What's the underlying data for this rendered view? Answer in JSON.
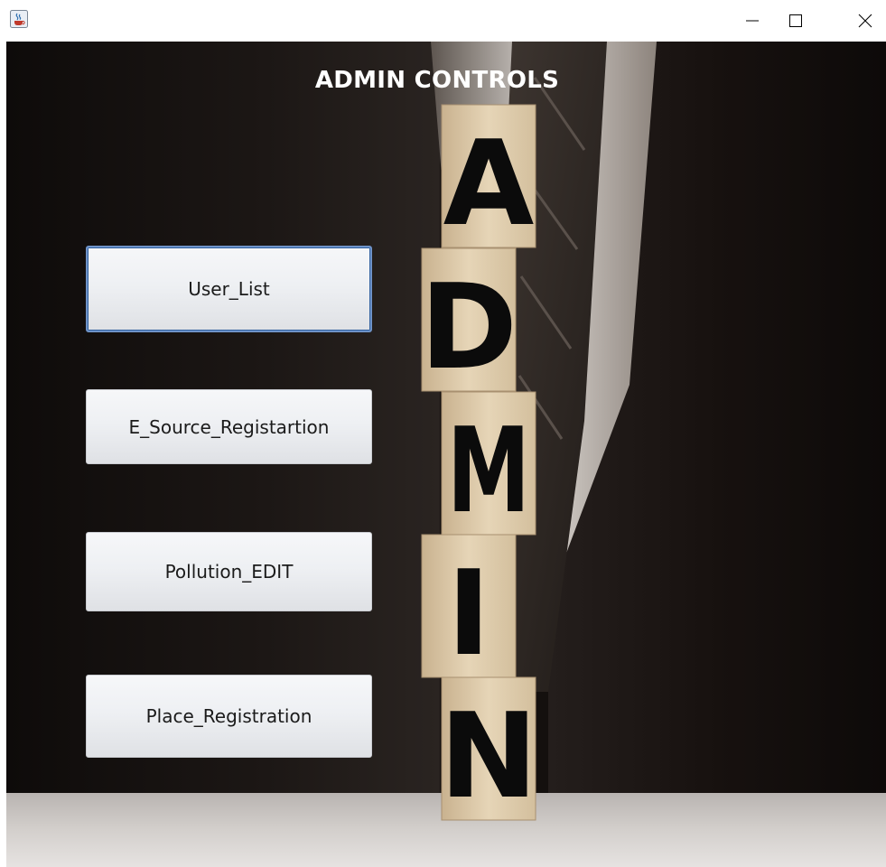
{
  "window": {
    "icon": "java-cup-icon",
    "controls": [
      "minimize-icon",
      "maximize-icon",
      "close-icon"
    ]
  },
  "heading": "ADMIN CONTROLS",
  "buttons": {
    "user_list": "User_List",
    "e_source_registration": "E_Source_Registartion",
    "pollution_edit": "Pollution_EDIT",
    "place_registration": "Place_Registration"
  },
  "background": {
    "blocks": [
      "A",
      "D",
      "M",
      "I",
      "N"
    ]
  },
  "colors": {
    "accent_focus": "#6f93c8",
    "background_dark": "#14100e"
  }
}
